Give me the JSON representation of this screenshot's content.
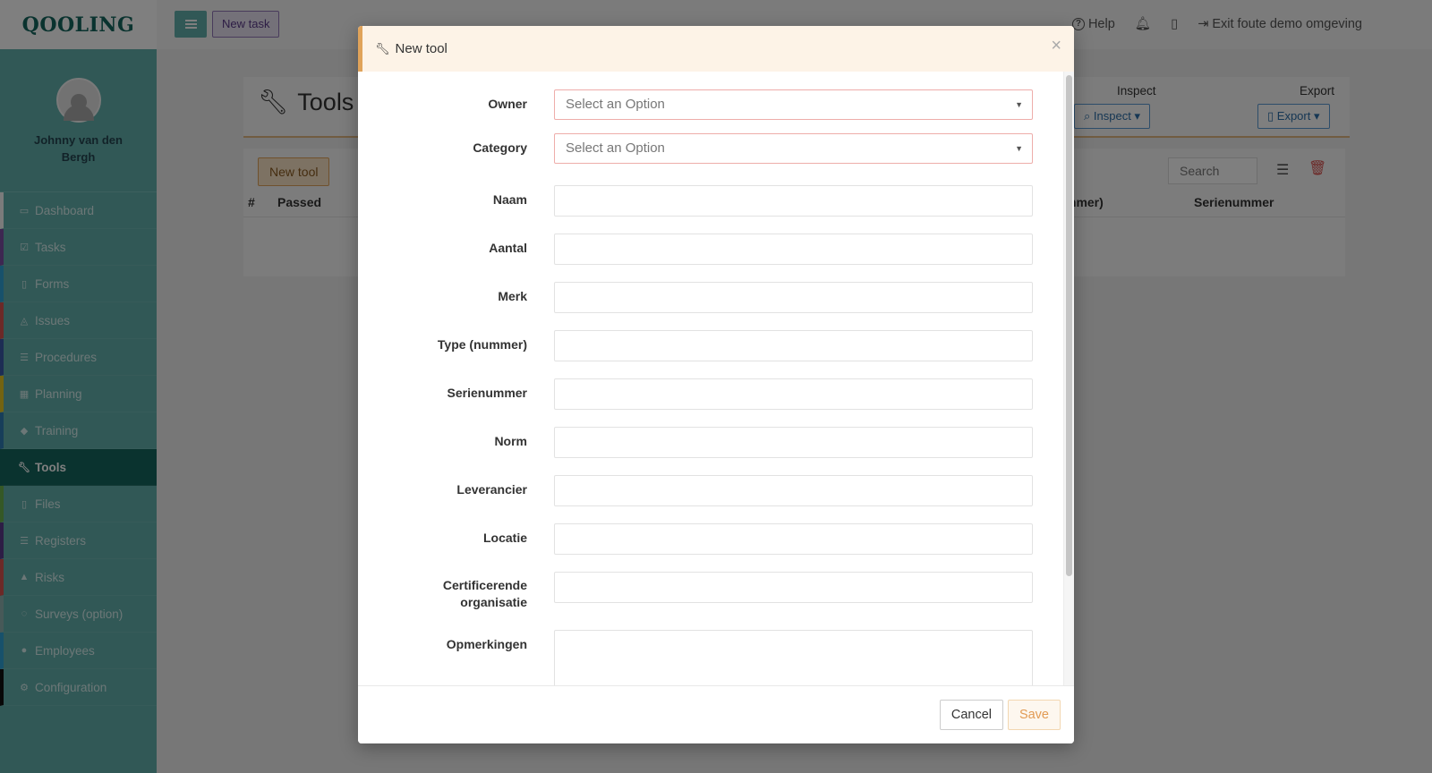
{
  "brand": "QOOLING",
  "user": {
    "name": "Johnny van den Bergh"
  },
  "sidebar": {
    "items": [
      {
        "label": "Dashboard",
        "icon": "monitor-icon",
        "accent": "#f7f7f7"
      },
      {
        "label": "Tasks",
        "icon": "check-square-icon",
        "accent": "#7b4fa3"
      },
      {
        "label": "Forms",
        "icon": "file-icon",
        "accent": "#2ea3d6"
      },
      {
        "label": "Issues",
        "icon": "bell-icon",
        "accent": "#d9534f"
      },
      {
        "label": "Procedures",
        "icon": "list-icon",
        "accent": "#3b5ba9"
      },
      {
        "label": "Planning",
        "icon": "calendar-icon",
        "accent": "#e7c623"
      },
      {
        "label": "Training",
        "icon": "graduation-cap-icon",
        "accent": "#2e7db5"
      },
      {
        "label": "Tools",
        "icon": "wrench-icon",
        "accent": "#14665f",
        "active": true
      },
      {
        "label": "Files",
        "icon": "file-icon",
        "accent": "#6ab04c"
      },
      {
        "label": "Registers",
        "icon": "list-icon",
        "accent": "#5b3a8a"
      },
      {
        "label": "Risks",
        "icon": "warning-icon",
        "accent": "#d9534f"
      },
      {
        "label": "Surveys (option)",
        "icon": "comment-icon",
        "accent": "#8fb3b1"
      },
      {
        "label": "Employees",
        "icon": "users-icon",
        "accent": "#2ea3d6"
      },
      {
        "label": "Configuration",
        "icon": "gear-icon",
        "accent": "#111111"
      }
    ]
  },
  "topbar": {
    "new_task": "New task",
    "help": "Help",
    "exit": "Exit foute demo omgeving"
  },
  "page": {
    "title": "Tools",
    "inspect_label": "Inspect",
    "inspect_button": "Inspect",
    "export_label": "Export",
    "export_button": "Export",
    "new_tool_button": "New tool",
    "search_placeholder": "Search",
    "columns": [
      "#",
      "Passed",
      "mmer)",
      "Serienummer"
    ]
  },
  "modal": {
    "title": "New tool",
    "fields": {
      "owner": {
        "label": "Owner",
        "placeholder": "Select an Option"
      },
      "category": {
        "label": "Category",
        "placeholder": "Select an Option"
      },
      "naam": "Naam",
      "aantal": "Aantal",
      "merk": "Merk",
      "type": "Type (nummer)",
      "serienummer": "Serienummer",
      "norm": "Norm",
      "leverancier": "Leverancier",
      "locatie": "Locatie",
      "cert_line1": "Certificerende",
      "cert_line2": "organisatie",
      "opmerkingen": "Opmerkingen"
    },
    "cancel": "Cancel",
    "save": "Save"
  },
  "colors": {
    "sidebar_bg": "#62b0ac",
    "active_nav": "#14665f",
    "modal_accent": "#e0a35a",
    "required_border": "#eeadaa"
  }
}
